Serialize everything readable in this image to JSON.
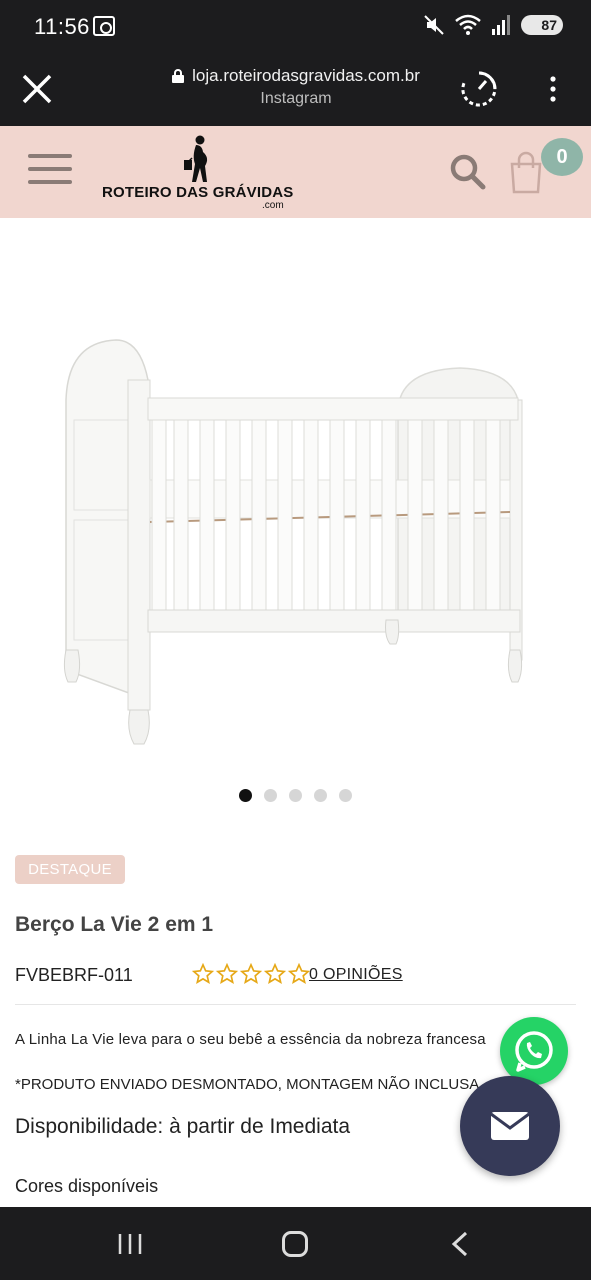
{
  "status_bar": {
    "time": "11:56",
    "battery": "87"
  },
  "browser": {
    "url": "loja.roteirodasgravidas.com.br",
    "source": "Instagram"
  },
  "site": {
    "logo_text": "ROTEIRO DAS GRÁVIDAS",
    "logo_domain": ".com",
    "cart_count": "0",
    "brand_color": "#f1d6cf",
    "accent_color": "#8fb5a8"
  },
  "carousel": {
    "total": 5,
    "active": 1
  },
  "product": {
    "badge": "DESTAQUE",
    "title": "Berço La Vie 2 em 1",
    "sku": "FVBEBRF-011",
    "rating_stars": 0,
    "rating_max": 5,
    "reviews_link": "0 OPINIÕES",
    "description": "A Linha La Vie leva para o seu bebê a essência da nobreza francesa",
    "notice": "*PRODUTO ENVIADO DESMONTADO, MONTAGEM NÃO INCLUSA",
    "availability": "Disponibilidade: à partir de Imediata",
    "colors_label": "Cores disponíveis"
  }
}
